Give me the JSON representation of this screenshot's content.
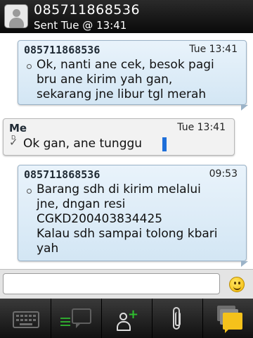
{
  "header": {
    "contact_number": "085711868536",
    "status": "Sent Tue @ 13:41"
  },
  "messages": [
    {
      "direction": "incoming",
      "sender": "085711868536",
      "time": "Tue 13:41",
      "text": "Ok, nanti ane cek, besok pagi\nbru ane kirim yah gan,\nsekarang jne libur tgl merah"
    },
    {
      "direction": "outgoing",
      "sender": "Me",
      "time": "Tue 13:41",
      "status_glyph": "D",
      "text": "Ok gan, ane tunggu"
    },
    {
      "direction": "incoming",
      "sender": "085711868536",
      "time": "09:53",
      "text": "Barang sdh di kirim melalui\njne, dngan resi\nCGKD200403834425\nKalau sdh sampai tolong kbari\nyah"
    }
  ],
  "composer": {
    "value": "",
    "placeholder": ""
  },
  "toolbar": {
    "icons": [
      "keyboard-icon",
      "chat-icon",
      "add-contact-icon",
      "attachment-icon",
      "conversations-icon"
    ]
  },
  "colors": {
    "header_bg": "#111111",
    "incoming_bubble": "#dcebf7",
    "outgoing_bubble": "#f2f2f2",
    "cursor": "#1e6fd9",
    "add_contact_plus": "#2ebd2e",
    "conversations_accent": "#f5c21b"
  }
}
